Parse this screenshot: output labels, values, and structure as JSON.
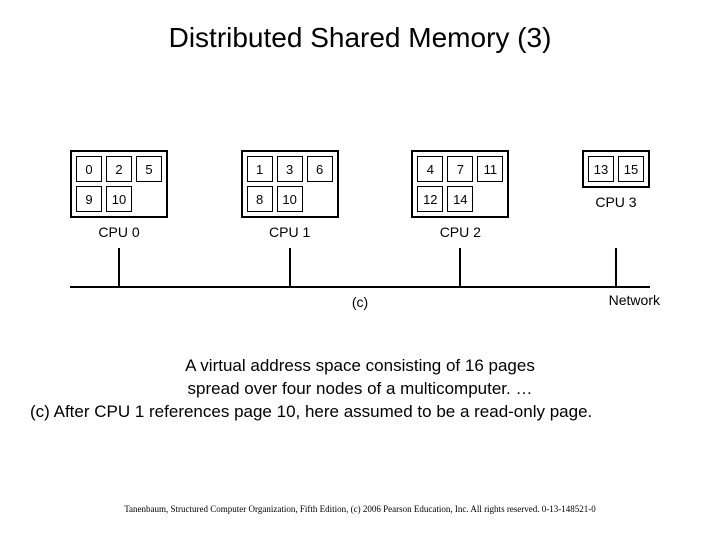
{
  "title": "Distributed Shared Memory (3)",
  "cpus": [
    {
      "label": "CPU 0",
      "row0": [
        "0",
        "2",
        "5"
      ],
      "row1": [
        "9",
        "10",
        ""
      ]
    },
    {
      "label": "CPU 1",
      "row0": [
        "1",
        "3",
        "6"
      ],
      "row1": [
        "8",
        "10",
        ""
      ]
    },
    {
      "label": "CPU 2",
      "row0": [
        "4",
        "7",
        "11"
      ],
      "row1": [
        "12",
        "14",
        ""
      ]
    },
    {
      "label": "CPU 3",
      "row0": [
        "13",
        "15"
      ],
      "row1": []
    }
  ],
  "sublabel": "(c)",
  "network_label": "Network",
  "caption": {
    "l1": "A virtual address space consisting of 16 pages",
    "l2": "spread over four nodes of a multicomputer.   …",
    "l3": "(c) After CPU 1 references page 10, here assumed to be a read-only page."
  },
  "footer": "Tanenbaum, Structured Computer Organization, Fifth Edition, (c) 2006 Pearson Education, Inc. All rights reserved. 0-13-148521-0"
}
